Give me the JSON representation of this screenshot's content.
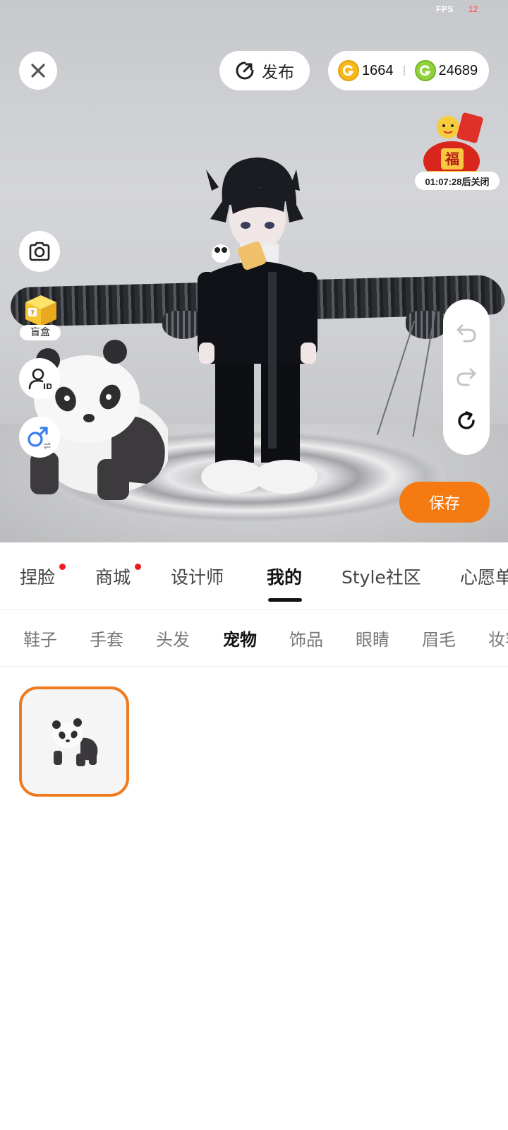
{
  "status": {
    "fps_label": "FPS",
    "fps_value": "12"
  },
  "header": {
    "publish_label": "发布",
    "currency": {
      "gold": "1664",
      "green": "24689"
    }
  },
  "event": {
    "timer": "01:07:28后关闭",
    "badge_text": "福"
  },
  "sidebar": {
    "blindbox_label": "盲盒"
  },
  "actions": {
    "save_label": "保存"
  },
  "main_tabs": [
    {
      "label": "捏脸",
      "dot": true
    },
    {
      "label": "商城",
      "dot": true
    },
    {
      "label": "设计师",
      "dot": false
    },
    {
      "label": "我的",
      "dot": false,
      "active": true
    },
    {
      "label": "Style社区",
      "dot": false
    },
    {
      "label": "心愿单",
      "dot": false
    }
  ],
  "sub_tabs": [
    {
      "label": "鞋子"
    },
    {
      "label": "手套"
    },
    {
      "label": "头发"
    },
    {
      "label": "宠物",
      "active": true
    },
    {
      "label": "饰品"
    },
    {
      "label": "眼睛"
    },
    {
      "label": "眉毛"
    },
    {
      "label": "妆容"
    }
  ],
  "items": [
    {
      "name": "panda-pet",
      "selected": true
    }
  ],
  "colors": {
    "accent": "#f57a12",
    "selected_border": "#f07a1e",
    "notification_dot": "#ee1c1c",
    "gold_coin": "#f6b91c",
    "green_coin": "#8fd23b"
  }
}
